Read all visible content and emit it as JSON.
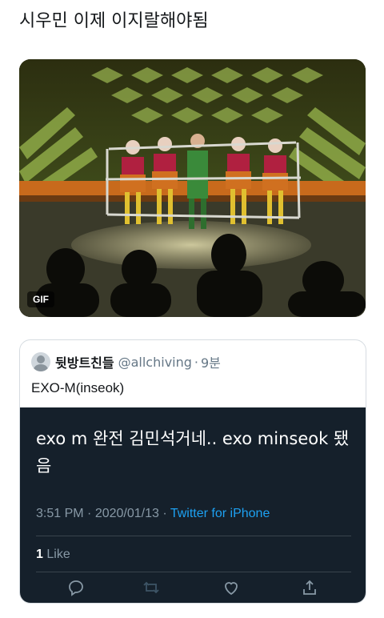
{
  "tweet": {
    "text": "시우민 이제 이지랄해야됨"
  },
  "media": {
    "badge": "GIF"
  },
  "quoted": {
    "display_name": "뒷방트친들",
    "handle": "@allchiving",
    "separator": "·",
    "time_ago": "9분",
    "text": "EXO-M(inseok)",
    "embedded": {
      "text": "exo m 완전 김민석거네.. exo minseok 됐음",
      "time": "3:51 PM",
      "date": "2020/01/13",
      "source": "Twitter for iPhone",
      "like_count": "1",
      "like_label": "Like"
    }
  },
  "icons": {
    "reply": "reply-icon",
    "retweet": "retweet-icon",
    "like": "heart-icon",
    "share": "share-icon"
  },
  "colors": {
    "dark_bg": "#15202b",
    "link_blue": "#1da1f2",
    "muted": "#8899a6"
  }
}
